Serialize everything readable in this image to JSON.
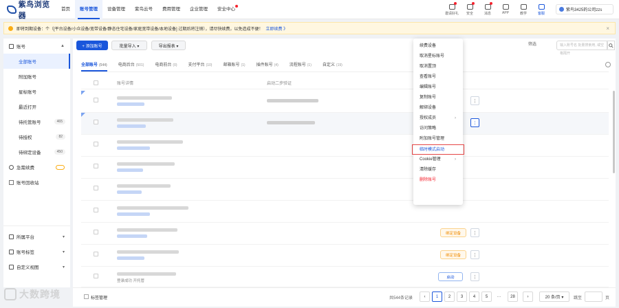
{
  "app": {
    "logo_text": "紫鸟浏览器"
  },
  "nav": {
    "items": [
      "首页",
      "账号管理",
      "设备管理",
      "紫鸟云号",
      "费用管理",
      "企业管理",
      "安全中心"
    ]
  },
  "toolbar": {
    "items": [
      "邀请好礼",
      "安全",
      "消息",
      "APP",
      "教学",
      "客服"
    ]
  },
  "account": {
    "name": "紫鸟3425的公司zzs"
  },
  "notice": {
    "text": "即将到期设备：个（[平台设备/小众设备/宽带设备/静态住宅设备/家庭宽带设备/本地设备] 过期后将注销），请尽快续费，以免造成不便！",
    "link": "立即续费 》",
    "close": "×"
  },
  "sidebar": {
    "head": "账号",
    "items": [
      {
        "label": "全部账号"
      },
      {
        "label": "附加账号"
      },
      {
        "label": "星标账号"
      },
      {
        "label": "最近打开"
      },
      {
        "label": "待托管账号",
        "count": "465"
      },
      {
        "label": "待授权",
        "count": "82"
      },
      {
        "label": "待绑定设备",
        "count": "450"
      }
    ],
    "extra": [
      "急需续费",
      "账号回收站"
    ],
    "bottom": [
      "所属平台",
      "账号标签",
      "自定义视图"
    ]
  },
  "actions": {
    "add": "+ 添加账号",
    "import": "批量导入 ▾",
    "export": "导出报表 ▾",
    "filter": "筛选",
    "search_placeholder": "输入账号名 批量搜索用, 或空格隔开"
  },
  "tabs": [
    {
      "label": "全部账号",
      "count": "(544)"
    },
    {
      "label": "电商后台",
      "count": "(501)"
    },
    {
      "label": "电商前台",
      "count": "(0)"
    },
    {
      "label": "支付平台",
      "count": "(10)"
    },
    {
      "label": "邮箱账号",
      "count": "(1)"
    },
    {
      "label": "插件账号",
      "count": "(4)"
    },
    {
      "label": "流程账号",
      "count": "(1)"
    },
    {
      "label": "自定义",
      "count": "(19)"
    }
  ],
  "table": {
    "headers": [
      "账号详情",
      "启动二步验证"
    ],
    "bind_label": "绑定设备",
    "start_label": "启动",
    "last_row_text": "登录成功 开托管"
  },
  "menu": {
    "items": [
      "续费设备",
      "取消星标账号",
      "取消置顶",
      "查看账号",
      "编辑账号",
      "复制账号",
      "解绑设备",
      "授权成员",
      "访问策略",
      "附加账号管理",
      "临时模式启动",
      "Cookie管理",
      "清除缓存",
      "删除账号"
    ]
  },
  "footer": {
    "label": "标签管理",
    "total": "共544条记录",
    "pages": [
      "‹",
      "1",
      "2",
      "3",
      "4",
      "5",
      "···",
      "28",
      "›"
    ],
    "page_size": "20 条/页 ▾",
    "jump_label": "跳至",
    "jump_unit": "页"
  },
  "watermark": {
    "text": "大数跨境"
  },
  "colors": {
    "accent": "#1a56db",
    "warning": "#faad14",
    "danger": "#f5222d",
    "bind": "#f08c00"
  }
}
